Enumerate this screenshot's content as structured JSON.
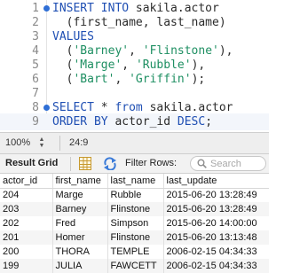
{
  "editor": {
    "lines": [
      {
        "number": "1",
        "bullet": true,
        "tokens": [
          {
            "t": "kw",
            "v": "INSERT INTO"
          },
          {
            "t": "plain",
            "v": " sakila.actor"
          }
        ]
      },
      {
        "number": "2",
        "bullet": false,
        "tokens": [
          {
            "t": "plain",
            "v": "  (first_name, last_name)"
          }
        ]
      },
      {
        "number": "3",
        "bullet": false,
        "tokens": [
          {
            "t": "kw",
            "v": "VALUES"
          }
        ]
      },
      {
        "number": "4",
        "bullet": false,
        "tokens": [
          {
            "t": "plain",
            "v": "  ("
          },
          {
            "t": "str",
            "v": "'Barney'"
          },
          {
            "t": "plain",
            "v": ", "
          },
          {
            "t": "str",
            "v": "'Flinstone'"
          },
          {
            "t": "plain",
            "v": "),"
          }
        ]
      },
      {
        "number": "5",
        "bullet": false,
        "tokens": [
          {
            "t": "plain",
            "v": "  ("
          },
          {
            "t": "str",
            "v": "'Marge'"
          },
          {
            "t": "plain",
            "v": ", "
          },
          {
            "t": "str",
            "v": "'Rubble'"
          },
          {
            "t": "plain",
            "v": "),"
          }
        ]
      },
      {
        "number": "6",
        "bullet": false,
        "tokens": [
          {
            "t": "plain",
            "v": "  ("
          },
          {
            "t": "str",
            "v": "'Bart'"
          },
          {
            "t": "plain",
            "v": ", "
          },
          {
            "t": "str",
            "v": "'Griffin'"
          },
          {
            "t": "plain",
            "v": ");"
          }
        ]
      },
      {
        "number": "7",
        "bullet": false,
        "tokens": []
      },
      {
        "number": "8",
        "bullet": true,
        "tokens": [
          {
            "t": "kw",
            "v": "SELECT"
          },
          {
            "t": "plain",
            "v": " * "
          },
          {
            "t": "kw",
            "v": "from"
          },
          {
            "t": "plain",
            "v": " sakila.actor"
          }
        ]
      },
      {
        "number": "9",
        "bullet": false,
        "current": true,
        "tokens": [
          {
            "t": "kw",
            "v": "ORDER BY"
          },
          {
            "t": "plain",
            "v": " actor_id "
          },
          {
            "t": "kw",
            "v": "DESC"
          },
          {
            "t": "plain",
            "v": ";"
          }
        ]
      }
    ]
  },
  "statusbar": {
    "zoom": "100%",
    "cursor_position": "24:9"
  },
  "result_toolbar": {
    "title": "Result Grid",
    "filter_label": "Filter Rows:",
    "search_placeholder": "Search",
    "icons": [
      "grid-layout-icon",
      "refresh-icon",
      "search-icon"
    ]
  },
  "result_grid": {
    "columns": [
      "actor_id",
      "first_name",
      "last_name",
      "last_update"
    ],
    "rows": [
      [
        "204",
        "Marge",
        "Rubble",
        "2015-06-20 13:28:49"
      ],
      [
        "203",
        "Barney",
        "Flinstone",
        "2015-06-20 13:28:49"
      ],
      [
        "202",
        "Fred",
        "Simpson",
        "2015-06-20 14:00:00"
      ],
      [
        "201",
        "Homer",
        "Flinstone",
        "2015-06-20 13:13:48"
      ],
      [
        "200",
        "THORA",
        "TEMPLE",
        "2006-02-15 04:34:33"
      ],
      [
        "199",
        "JULIA",
        "FAWCETT",
        "2006-02-15 04:34:33"
      ]
    ]
  },
  "colors": {
    "keyword": "#1f4fb3",
    "string": "#1e8f62",
    "bullet": "#2f6fd6",
    "line_number": "#8a8a8a"
  }
}
